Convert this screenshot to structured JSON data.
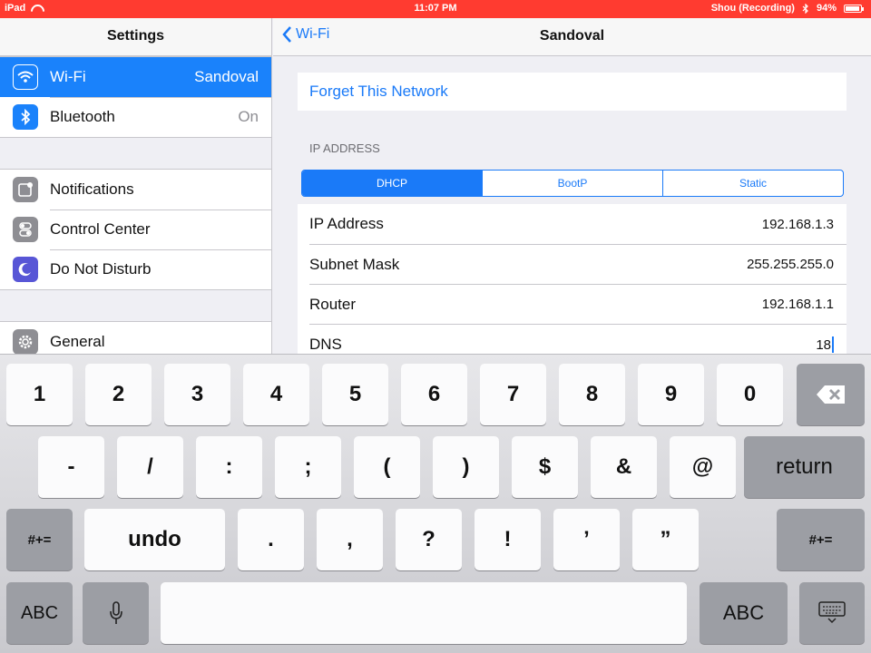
{
  "statusbar": {
    "device": "iPad",
    "time": "11:07 PM",
    "user": "Shou (Recording)",
    "battery": "94%",
    "battery_fraction": 0.94,
    "bg_color": "#ff3b30"
  },
  "sidebar": {
    "title": "Settings",
    "group1": [
      {
        "label": "Wi-Fi",
        "value": "Sandoval",
        "icon": "wifi-icon",
        "color": "#1a82fb",
        "selected": true
      },
      {
        "label": "Bluetooth",
        "value": "On",
        "icon": "bluetooth-icon",
        "color": "#1a82fb",
        "selected": false
      }
    ],
    "group2": [
      {
        "label": "Notifications",
        "icon": "notifications-icon",
        "color": "#8e8e93"
      },
      {
        "label": "Control Center",
        "icon": "control-center-icon",
        "color": "#8e8e93"
      },
      {
        "label": "Do Not Disturb",
        "icon": "moon-icon",
        "color": "#5856d6"
      }
    ],
    "group3": [
      {
        "label": "General",
        "icon": "gear-icon",
        "color": "#8e8e93"
      }
    ]
  },
  "main": {
    "back_label": "Wi-Fi",
    "title": "Sandoval",
    "forget_label": "Forget This Network",
    "section_title": "IP ADDRESS",
    "segments": [
      "DHCP",
      "BootP",
      "Static"
    ],
    "selected_segment": "DHCP",
    "rows": [
      {
        "key": "IP Address",
        "value": "192.168.1.3"
      },
      {
        "key": "Subnet Mask",
        "value": "255.255.255.0"
      },
      {
        "key": "Router",
        "value": "192.168.1.1"
      },
      {
        "key": "DNS",
        "value": "18"
      }
    ],
    "accent": "#1a7af8"
  },
  "keyboard": {
    "row1": [
      "1",
      "2",
      "3",
      "4",
      "5",
      "6",
      "7",
      "8",
      "9",
      "0"
    ],
    "row2": [
      "-",
      "/",
      ":",
      ";",
      "(",
      ")",
      "$",
      "&",
      "@"
    ],
    "return_label": "return",
    "row3_left": "#+=",
    "undo_label": "undo",
    "row3": [
      ".",
      ",",
      "?",
      "!",
      "’",
      "”"
    ],
    "row3_right": "#+=",
    "abc_label": "ABC",
    "icons": [
      "delete-icon",
      "microphone-icon",
      "keyboard-dismiss-icon"
    ]
  }
}
